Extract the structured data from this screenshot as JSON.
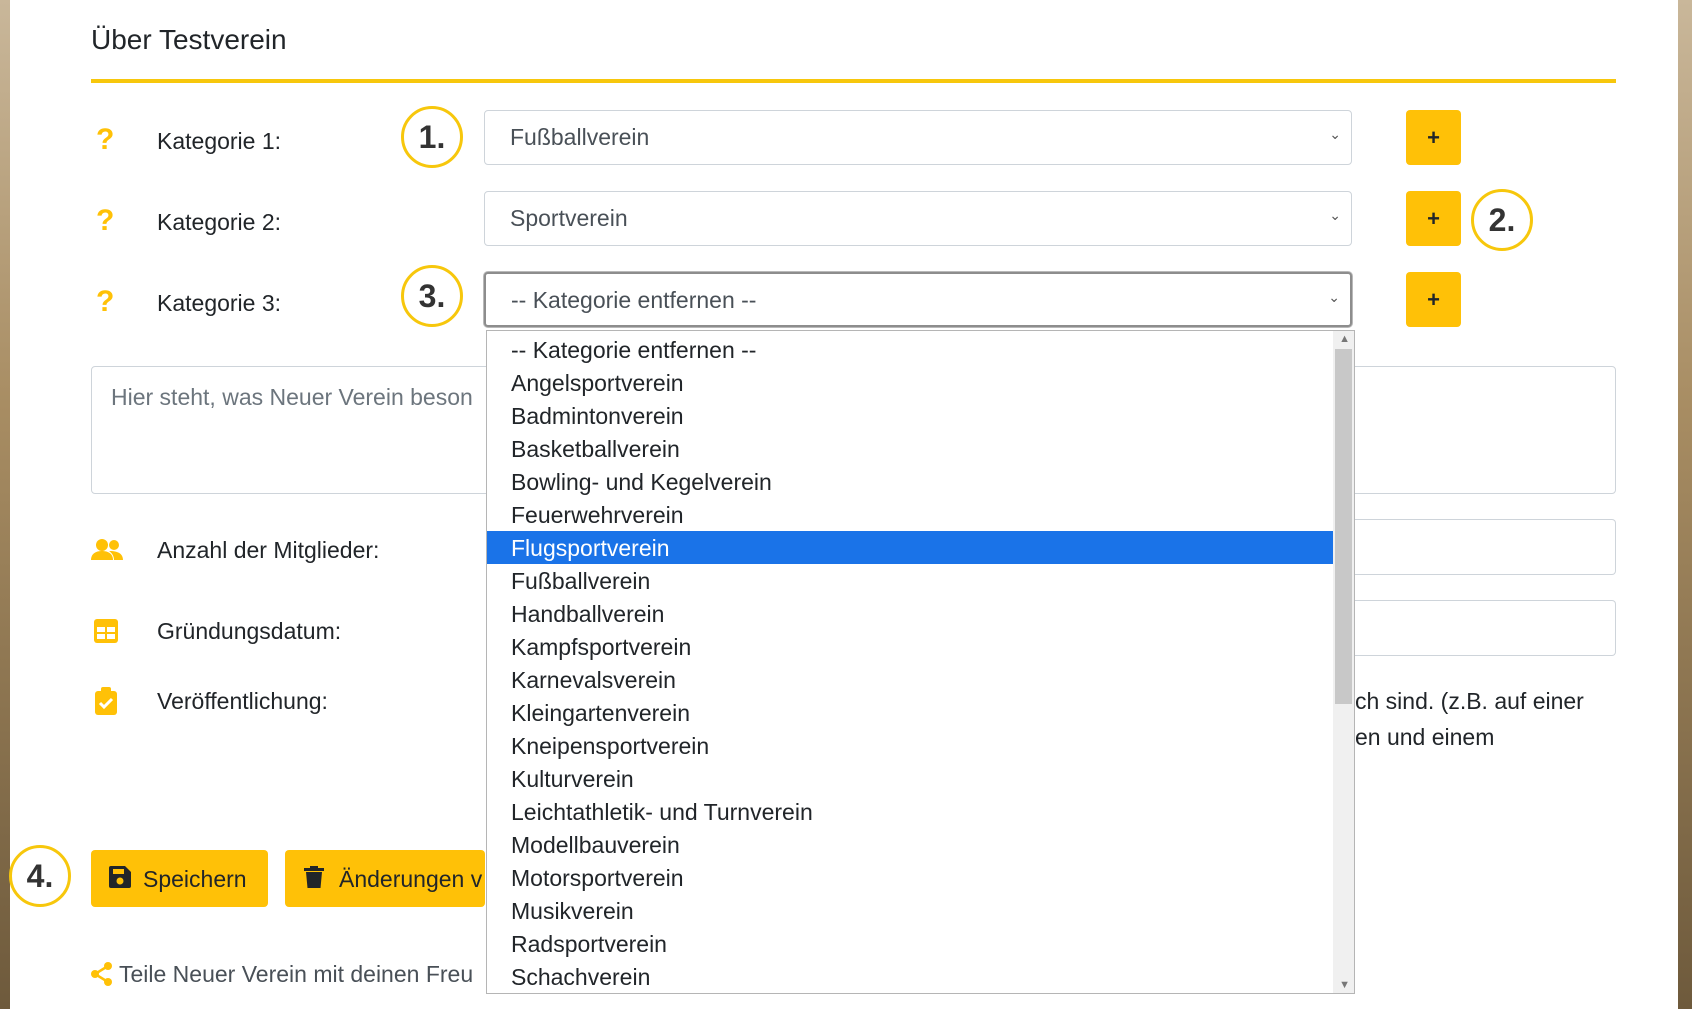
{
  "section_title": "Über Testverein",
  "categories": [
    {
      "label": "Kategorie 1:",
      "value": "Fußballverein"
    },
    {
      "label": "Kategorie 2:",
      "value": "Sportverein"
    },
    {
      "label": "Kategorie 3:",
      "value": "-- Kategorie entfernen --"
    }
  ],
  "plus_label": "+",
  "step_markers": [
    "1.",
    "2.",
    "3.",
    "4."
  ],
  "description_placeholder": "Hier steht, was Neuer Verein beson",
  "fields": {
    "members_label": "Anzahl der Mitglieder:",
    "founding_label": "Gründungsdatum:",
    "publication_label": "Veröffentlichung:",
    "publication_text_1": "ch sind. (z.B. auf einer",
    "publication_text_2": "en und einem"
  },
  "buttons": {
    "save": "Speichern",
    "discard": "Änderungen v"
  },
  "share_text": "Teile Neuer Verein mit deinen Freu",
  "dropdown": {
    "selected": "Flugsportverein",
    "options": [
      "-- Kategorie entfernen --",
      "Angelsportverein",
      "Badmintonverein",
      "Basketballverein",
      "Bowling- und Kegelverein",
      "Feuerwehrverein",
      "Flugsportverein",
      "Fußballverein",
      "Handballverein",
      "Kampfsportverein",
      "Karnevalsverein",
      "Kleingartenverein",
      "Kneipensportverein",
      "Kulturverein",
      "Leichtathletik- und Turnverein",
      "Modellbauverein",
      "Motorsportverein",
      "Musikverein",
      "Radsportverein",
      "Schachverein"
    ]
  },
  "colors": {
    "accent": "#ffc107",
    "rule": "#f7c70c",
    "highlight": "#1a73e8"
  }
}
